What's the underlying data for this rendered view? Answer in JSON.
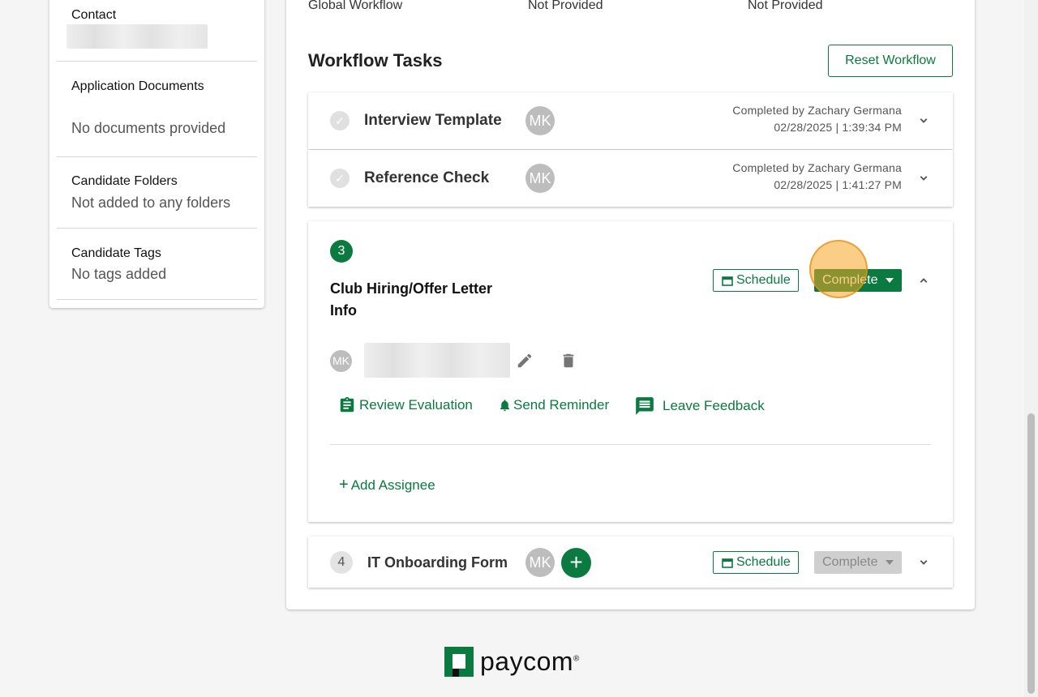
{
  "sidebar": {
    "contact_label": "Contact",
    "documents": {
      "title": "Application Documents",
      "value": "No documents provided"
    },
    "folders": {
      "title": "Candidate Folders",
      "value": "Not added to any folders"
    },
    "tags": {
      "title": "Candidate Tags",
      "value": "No tags added"
    }
  },
  "global_workflow": {
    "label": "Global Workflow",
    "value1": "Not Provided",
    "value2": "Not Provided"
  },
  "workflow": {
    "title": "Workflow Tasks",
    "reset_label": "Reset Workflow",
    "tasks": [
      {
        "name": "Interview Template",
        "avatar": "MK",
        "completed_by": "Completed by Zachary Germana",
        "completed_at": "02/28/2025 | 1:39:34 PM"
      },
      {
        "name": "Reference Check",
        "avatar": "MK",
        "completed_by": "Completed by Zachary Germana",
        "completed_at": "02/28/2025 | 1:41:27 PM"
      },
      {
        "number": "3",
        "name_line1": "Club Hiring/Offer Letter",
        "name_line2": "Info",
        "schedule_label": "Schedule",
        "complete_label": "Complete",
        "assignee_avatar": "MK",
        "actions": {
          "review": "Review Evaluation",
          "reminder": "Send Reminder",
          "feedback": "Leave Feedback"
        },
        "add_assignee": "Add Assignee"
      },
      {
        "number": "4",
        "name": "IT Onboarding Form",
        "avatar": "MK",
        "schedule_label": "Schedule",
        "complete_label": "Complete"
      }
    ]
  },
  "footer": {
    "logo_text": "paycom",
    "logo_mark": "®"
  },
  "colors": {
    "brand_green": "#0a7a40",
    "disabled_gray": "#cfcfcf",
    "highlight": "#f5a623"
  }
}
